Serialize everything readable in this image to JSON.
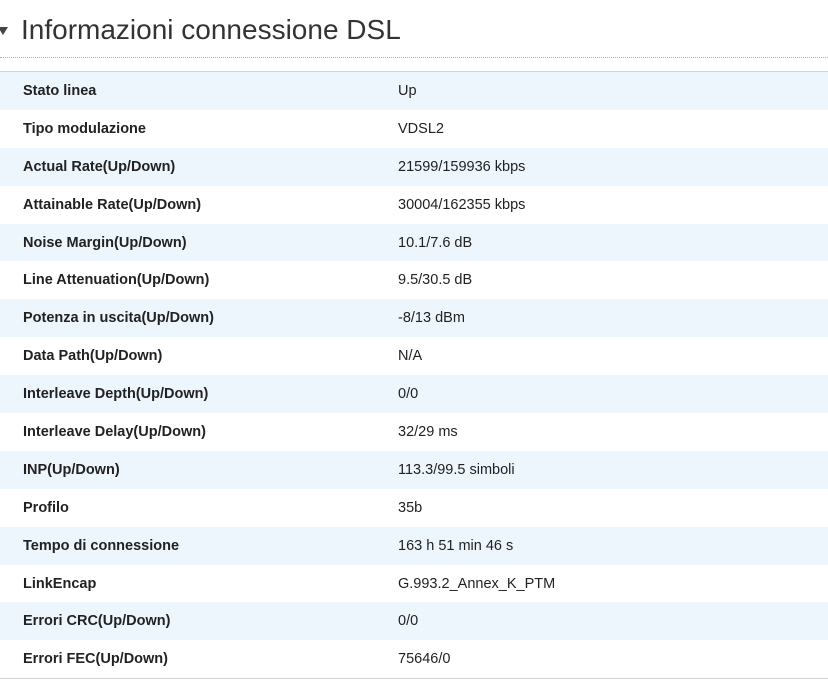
{
  "section": {
    "title": "Informazioni connessione DSL"
  },
  "rows": [
    {
      "label": "Stato linea",
      "value": "Up"
    },
    {
      "label": "Tipo modulazione",
      "value": "VDSL2"
    },
    {
      "label": "Actual Rate(Up/Down)",
      "value": "21599/159936 kbps"
    },
    {
      "label": "Attainable Rate(Up/Down)",
      "value": "30004/162355 kbps"
    },
    {
      "label": "Noise Margin(Up/Down)",
      "value": "10.1/7.6 dB"
    },
    {
      "label": "Line Attenuation(Up/Down)",
      "value": "9.5/30.5 dB"
    },
    {
      "label": "Potenza in uscita(Up/Down)",
      "value": "-8/13 dBm"
    },
    {
      "label": "Data Path(Up/Down)",
      "value": "N/A"
    },
    {
      "label": "Interleave Depth(Up/Down)",
      "value": "0/0"
    },
    {
      "label": "Interleave Delay(Up/Down)",
      "value": "32/29 ms"
    },
    {
      "label": "INP(Up/Down)",
      "value": "113.3/99.5 simboli"
    },
    {
      "label": "Profilo",
      "value": "35b"
    },
    {
      "label": "Tempo di connessione",
      "value": "163 h 51 min 46 s"
    },
    {
      "label": "LinkEncap",
      "value": "G.993.2_Annex_K_PTM"
    },
    {
      "label": "Errori CRC(Up/Down)",
      "value": "0/0"
    },
    {
      "label": "Errori FEC(Up/Down)",
      "value": "75646/0"
    }
  ]
}
